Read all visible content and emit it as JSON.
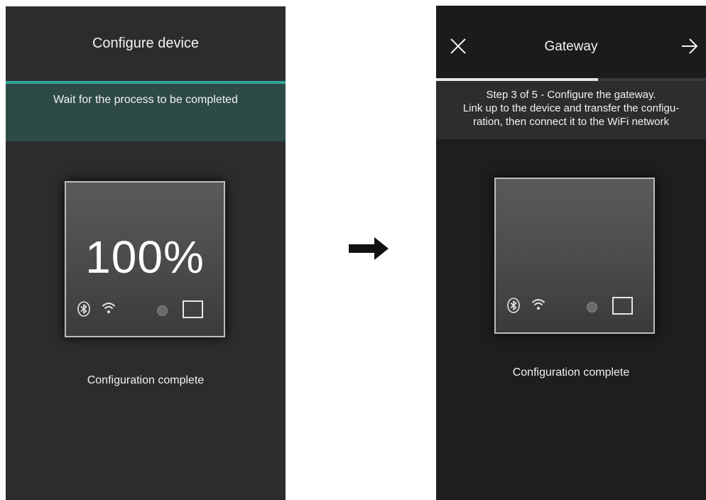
{
  "left_screen": {
    "title": "Configure device",
    "banner": "Wait for the process to be completed",
    "device": {
      "percent": "100%",
      "icons": [
        "bluetooth-icon",
        "wifi-icon",
        "led-icon",
        "square-button-icon"
      ]
    },
    "status": "Configuration complete"
  },
  "between_icon": "right-arrow-icon",
  "right_screen": {
    "title": "Gateway",
    "close_icon": "close-icon",
    "next_icon": "arrow-right-icon",
    "progress": 0.6,
    "step_lines": [
      "Step 3 of 5 - Configure the gateway.",
      "Link up to the device and transfer the configu-",
      "ration, then connect it to the WiFi network"
    ],
    "device": {
      "icons": [
        "bluetooth-icon",
        "wifi-icon",
        "led-icon",
        "square-button-icon"
      ]
    },
    "status": "Configuration complete"
  },
  "colors": {
    "left_background": "#2c2c2e",
    "accent_teal": "#2fa898",
    "banner_teal": "#2e4a47",
    "right_background": "#1e1e1f",
    "text": "#f2f2f2"
  }
}
